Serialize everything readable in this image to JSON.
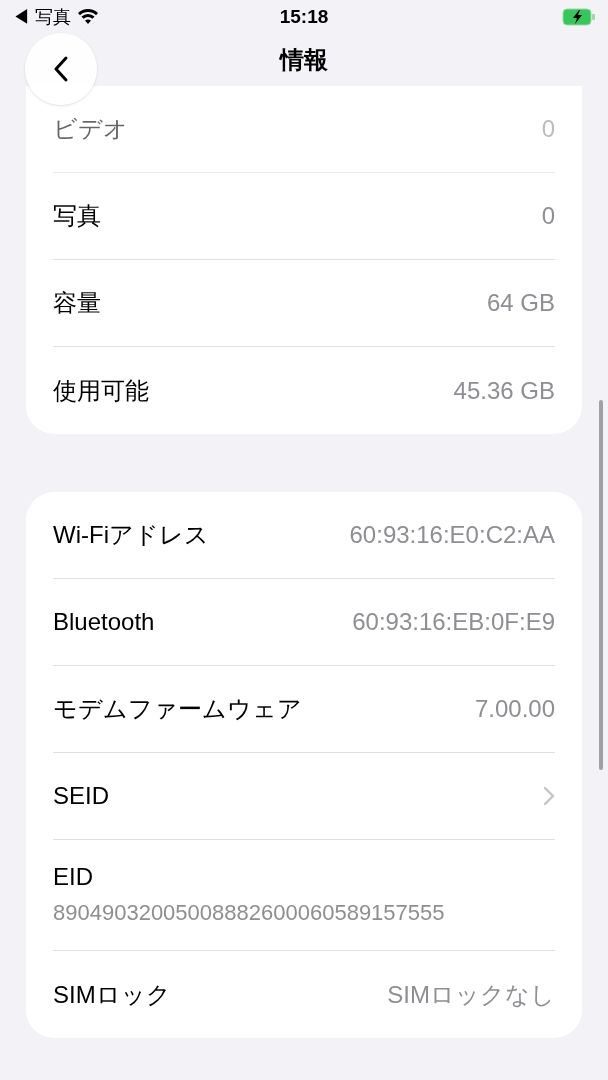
{
  "status_bar": {
    "back_app": "◀ 写真",
    "time": "15:18"
  },
  "header": {
    "title": "情報"
  },
  "sections": [
    {
      "rows": [
        {
          "kind": "value",
          "label": "ビデオ",
          "value": "0"
        },
        {
          "kind": "value",
          "label": "写真",
          "value": "0"
        },
        {
          "kind": "value",
          "label": "容量",
          "value": "64 GB"
        },
        {
          "kind": "value",
          "label": "使用可能",
          "value": "45.36 GB"
        }
      ]
    },
    {
      "rows": [
        {
          "kind": "value",
          "label": "Wi-Fiアドレス",
          "value": "60:93:16:E0:C2:AA"
        },
        {
          "kind": "value",
          "label": "Bluetooth",
          "value": "60:93:16:EB:0F:E9"
        },
        {
          "kind": "value",
          "label": "モデムファームウェア",
          "value": "7.00.00"
        },
        {
          "kind": "link",
          "label": "SEID"
        },
        {
          "kind": "stacked",
          "label": "EID",
          "value": "89049032005008882600060589157555"
        },
        {
          "kind": "value",
          "label": "SIMロック",
          "value": "SIMロックなし"
        }
      ]
    }
  ]
}
